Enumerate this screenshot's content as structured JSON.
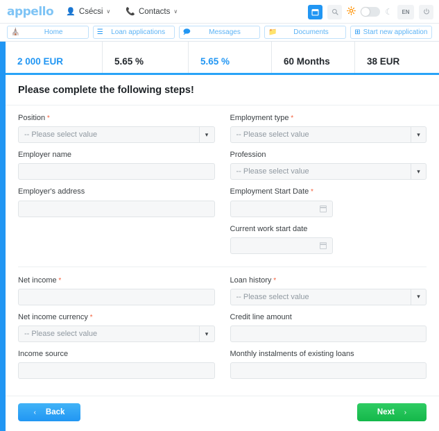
{
  "topbar": {
    "logo": "appello",
    "user_menu": {
      "label": "Csécsi",
      "icon": "user-icon",
      "caret": "∨"
    },
    "contacts_menu": {
      "label": "Contacts",
      "icon": "phone-icon",
      "caret": "∨"
    },
    "actions": {
      "calendar_icon": "🗓",
      "search_icon": "🔍",
      "brightness_icon": "☀",
      "theme_toggle": "theme-toggle",
      "moon_icon": "☾",
      "language": "EN",
      "power_icon": "⏻"
    }
  },
  "nav": {
    "tabs": [
      {
        "label": "Home",
        "icon": "🏠"
      },
      {
        "label": "Loan applications",
        "icon": "☰"
      },
      {
        "label": "Messages",
        "icon": "🗩"
      },
      {
        "label": "Documents",
        "icon": "📁"
      },
      {
        "label": "Start new application",
        "icon": "⊞"
      }
    ]
  },
  "summary": {
    "cells": [
      {
        "label": "",
        "value": "2 000 EUR",
        "accent": true
      },
      {
        "label": "",
        "value": "5.65 %",
        "accent": false
      },
      {
        "label": "",
        "value": "5.65 %",
        "accent": true
      },
      {
        "label": "",
        "value": "60 Months",
        "accent": false
      },
      {
        "label": "",
        "value": "38 EUR",
        "accent": false
      }
    ]
  },
  "form": {
    "heading": "Please complete the following steps!",
    "select_placeholder": "-- Please select value",
    "left_top": [
      {
        "label": "Position",
        "required": true,
        "type": "select",
        "value": ""
      },
      {
        "label": "Employer name",
        "required": false,
        "type": "text",
        "value": ""
      },
      {
        "label": "Employer's address",
        "required": false,
        "type": "text",
        "value": ""
      }
    ],
    "right_top": [
      {
        "label": "Employment type",
        "required": true,
        "type": "select",
        "value": ""
      },
      {
        "label": "Profession",
        "required": false,
        "type": "select",
        "value": ""
      },
      {
        "label": "Employment Start Date",
        "required": true,
        "type": "date",
        "value": ""
      },
      {
        "label": "Current work start date",
        "required": false,
        "type": "date",
        "value": ""
      }
    ],
    "left_bottom": [
      {
        "label": "Net income",
        "required": true,
        "type": "text",
        "value": ""
      },
      {
        "label": "Net income currency",
        "required": true,
        "type": "select",
        "value": ""
      },
      {
        "label": "Income source",
        "required": false,
        "type": "text",
        "value": ""
      }
    ],
    "right_bottom": [
      {
        "label": "Loan history",
        "required": true,
        "type": "select",
        "value": ""
      },
      {
        "label": "Credit line amount",
        "required": false,
        "type": "text",
        "value": ""
      },
      {
        "label": "Monthly instalments of existing loans",
        "required": false,
        "type": "text",
        "value": ""
      }
    ]
  },
  "footer": {
    "back_label": "Back",
    "back_arrow": "‹",
    "next_label": "Next",
    "next_arrow": "›"
  },
  "colors": {
    "brand_blue": "#2196f3",
    "accent_green": "#14b84a",
    "required_red": "#f4603c",
    "sun_orange": "#ff9100"
  }
}
